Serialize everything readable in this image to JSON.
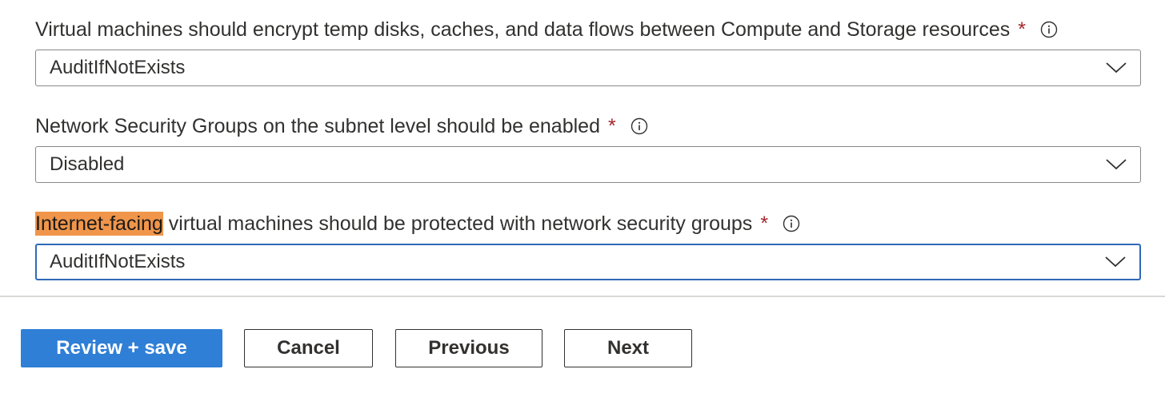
{
  "fields": [
    {
      "label_highlight": "",
      "label": "Virtual machines should encrypt temp disks, caches, and data flows between Compute and Storage resources",
      "required_mark": "*",
      "value": "AuditIfNotExists"
    },
    {
      "label_highlight": "",
      "label": "Network Security Groups on the subnet level should be enabled",
      "required_mark": "*",
      "value": "Disabled"
    },
    {
      "label_highlight": "Internet-facing",
      "label": " virtual machines should be protected with network security groups",
      "required_mark": "*",
      "value": "AuditIfNotExists"
    }
  ],
  "footer": {
    "review_save_label": "Review + save",
    "cancel_label": "Cancel",
    "previous_label": "Previous",
    "next_label": "Next"
  },
  "colors": {
    "primary": "#2f7fd6",
    "highlight": "#f0954a",
    "required": "#a4262c",
    "focus_border": "#2e69b8"
  },
  "icons": {
    "info": "info-icon",
    "dropdown": "chevron-down-icon"
  }
}
